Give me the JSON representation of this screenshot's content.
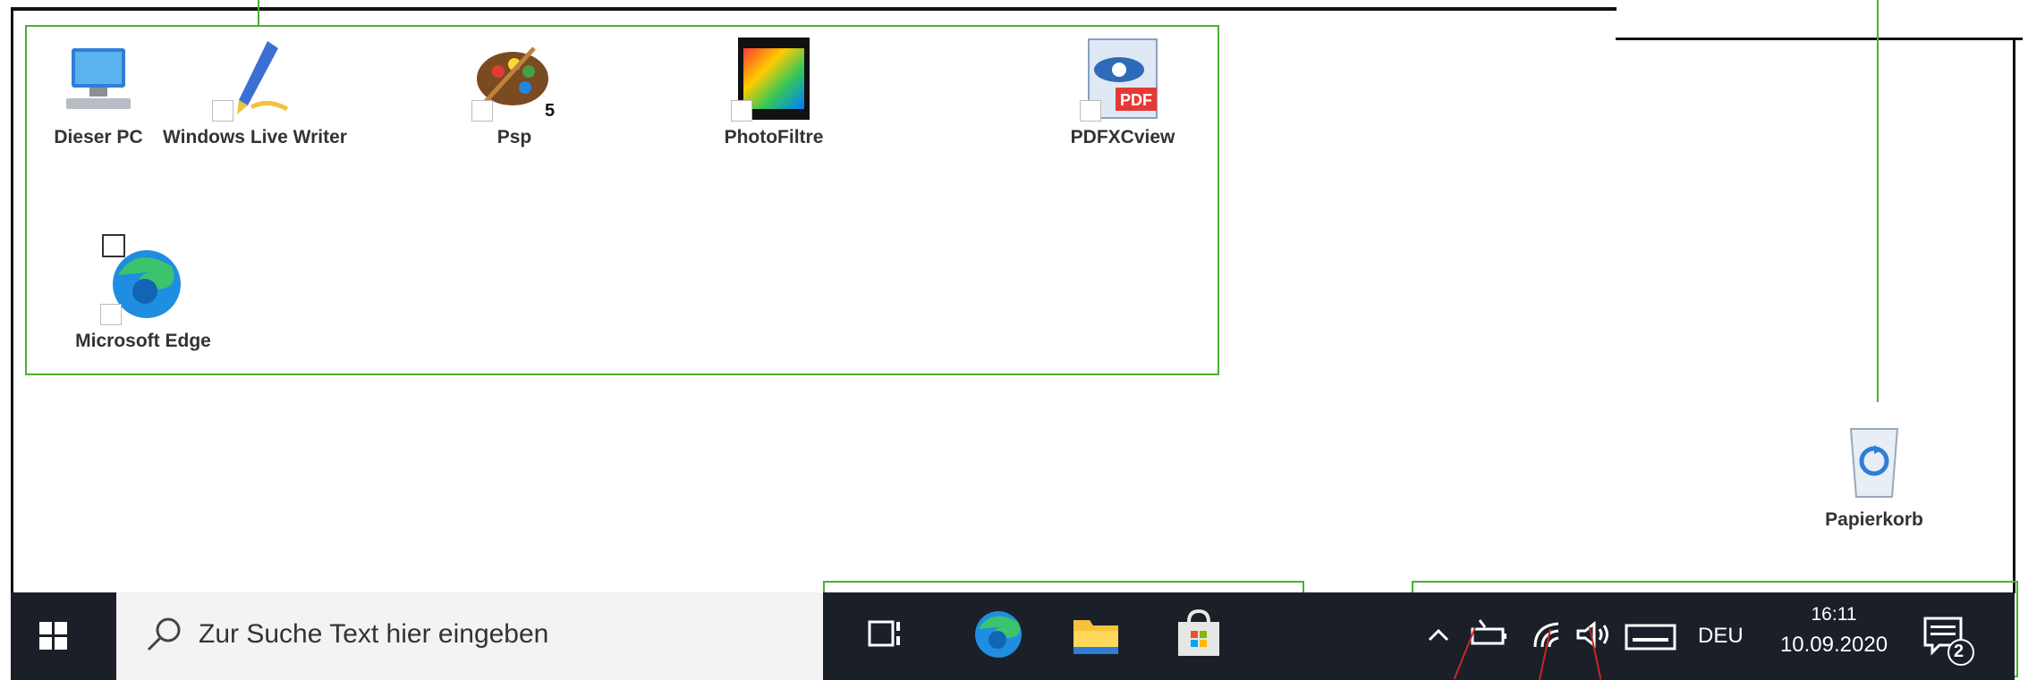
{
  "desktop": {
    "icons": [
      {
        "label": "Dieser PC",
        "icon": "computer-icon"
      },
      {
        "label": "Windows Live Writer",
        "icon": "pen-icon"
      },
      {
        "label": "Psp",
        "icon": "palette-icon"
      },
      {
        "label": "PhotoFiltre",
        "icon": "film-icon"
      },
      {
        "label": "PDFXCview",
        "icon": "pdf-eye-icon"
      },
      {
        "label": "Microsoft Edge",
        "icon": "edge-icon"
      }
    ],
    "recycle_bin": {
      "label": "Papierkorb",
      "icon": "recycle-bin-icon"
    }
  },
  "taskbar": {
    "start_icon": "windows-logo-icon",
    "search_placeholder": "Zur Suche Text hier eingeben",
    "pinned": [
      "task-view-icon",
      "edge-icon",
      "file-explorer-icon",
      "store-icon"
    ],
    "tray": {
      "language": "DEU",
      "time": "16:11",
      "date": "10.09.2020",
      "notifications": "2"
    }
  },
  "colors": {
    "taskbar": "#1b1f27",
    "highlight": "#4caf32",
    "pointer": "#c62828"
  }
}
